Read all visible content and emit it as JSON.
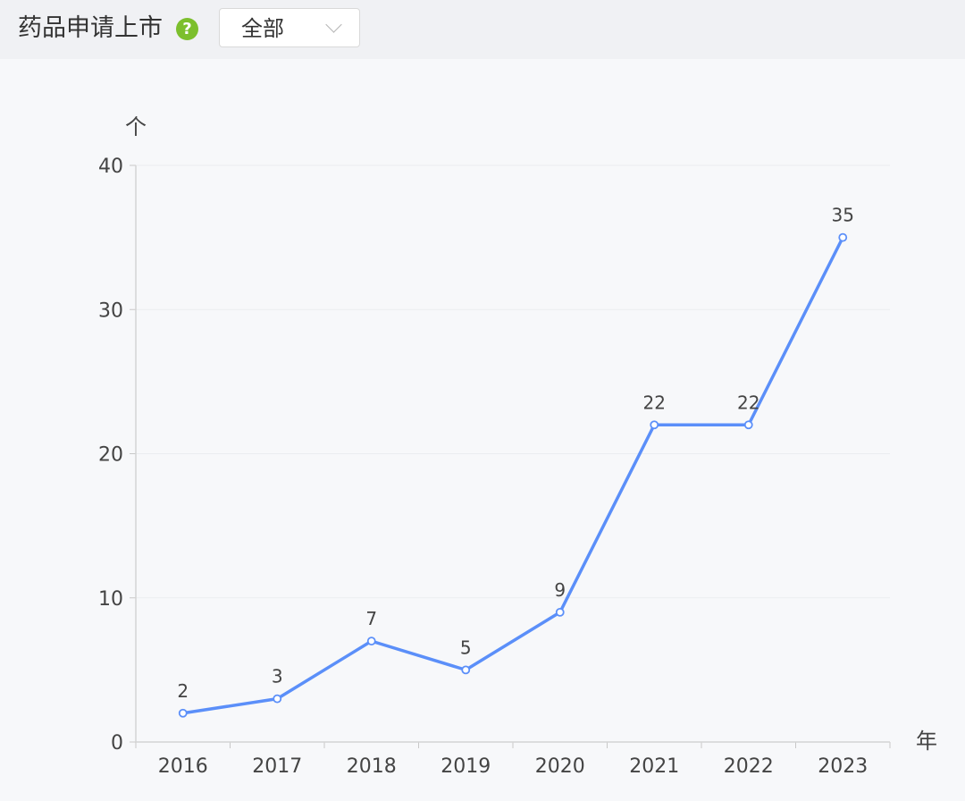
{
  "header": {
    "title": "药品申请上市",
    "help_icon": "question-circle-icon",
    "help_glyph": "?",
    "filter": {
      "selected": "全部",
      "icon": "chevron-down-icon"
    }
  },
  "colors": {
    "line": "#5b8ff9",
    "help_icon": "#7cbf2d",
    "gridline": "#ebedf0"
  },
  "chart_data": {
    "type": "line",
    "categories": [
      "2016",
      "2017",
      "2018",
      "2019",
      "2020",
      "2021",
      "2022",
      "2023"
    ],
    "values": [
      2,
      3,
      7,
      5,
      9,
      22,
      22,
      35
    ],
    "ylim": [
      0,
      40
    ],
    "yticks": [
      0,
      10,
      20,
      30,
      40
    ],
    "ylabel": "个",
    "xlabel": "年",
    "grid": true,
    "data_labels": true,
    "markers": "hollow-circle"
  }
}
